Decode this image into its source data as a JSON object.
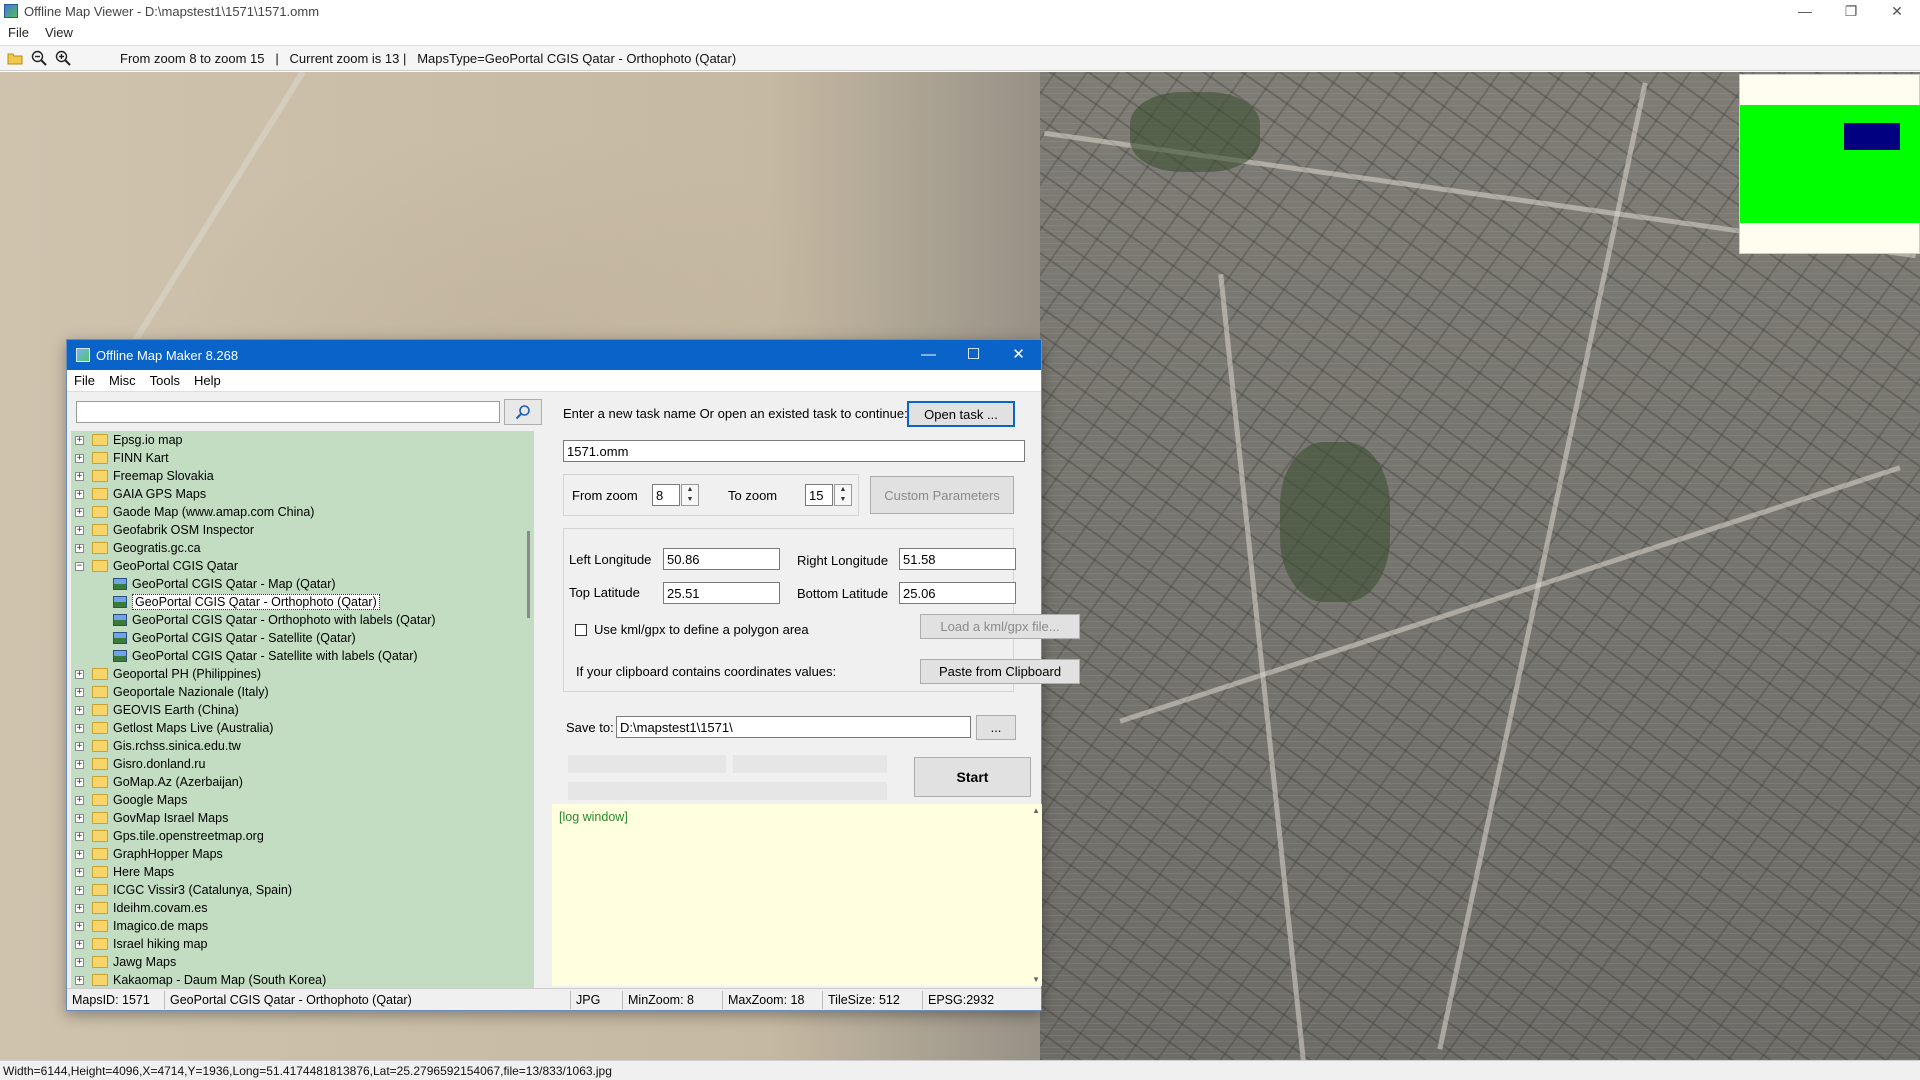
{
  "window": {
    "title": "Offline Map Viewer - D:\\mapstest1\\1571\\1571.omm",
    "minimize": "—",
    "maximize": "❐",
    "close": "✕"
  },
  "menu": [
    "File",
    "View"
  ],
  "toolbar": {
    "info": "From zoom 8 to zoom 15   |   Current zoom is 13 |   MapsType=GeoPortal CGIS Qatar - Orthophoto (Qatar)"
  },
  "statusbar": {
    "text": "Width=6144,Height=4096,X=4714,Y=1936,Long=51.4174481813876,Lat=25.2796592154067,file=13/833/1063.jpg"
  },
  "dialog": {
    "title": "Offline Map Maker 8.268",
    "minimize": "—",
    "maximize": "☐",
    "close": "✕",
    "menu": [
      "File",
      "Misc",
      "Tools",
      "Help"
    ],
    "search_placeholder": "",
    "tree": [
      {
        "label": "Epsg.io map",
        "type": "folder"
      },
      {
        "label": "FINN Kart",
        "type": "folder"
      },
      {
        "label": "Freemap Slovakia",
        "type": "folder"
      },
      {
        "label": "GAIA GPS Maps",
        "type": "folder"
      },
      {
        "label": "Gaode Map (www.amap.com China)",
        "type": "folder"
      },
      {
        "label": "Geofabrik OSM Inspector",
        "type": "folder"
      },
      {
        "label": "Geogratis.gc.ca",
        "type": "folder"
      },
      {
        "label": "GeoPortal CGIS Qatar",
        "type": "folder-open"
      },
      {
        "label": "GeoPortal CGIS Qatar - Map (Qatar)",
        "type": "child"
      },
      {
        "label": "GeoPortal CGIS Qatar - Orthophoto (Qatar)",
        "type": "child",
        "selected": true
      },
      {
        "label": "GeoPortal CGIS Qatar - Orthophoto with labels (Qatar)",
        "type": "child"
      },
      {
        "label": "GeoPortal CGIS Qatar - Satellite (Qatar)",
        "type": "child"
      },
      {
        "label": "GeoPortal CGIS Qatar - Satellite with labels (Qatar)",
        "type": "child"
      },
      {
        "label": "Geoportal PH (Philippines)",
        "type": "folder"
      },
      {
        "label": "Geoportale Nazionale (Italy)",
        "type": "folder"
      },
      {
        "label": "GEOVIS Earth (China)",
        "type": "folder"
      },
      {
        "label": "Getlost Maps Live (Australia)",
        "type": "folder"
      },
      {
        "label": "Gis.rchss.sinica.edu.tw",
        "type": "folder"
      },
      {
        "label": "Gisro.donland.ru",
        "type": "folder"
      },
      {
        "label": "GoMap.Az (Azerbaijan)",
        "type": "folder"
      },
      {
        "label": "Google Maps",
        "type": "folder"
      },
      {
        "label": "GovMap Israel Maps",
        "type": "folder"
      },
      {
        "label": "Gps.tile.openstreetmap.org",
        "type": "folder"
      },
      {
        "label": "GraphHopper Maps",
        "type": "folder"
      },
      {
        "label": "Here Maps",
        "type": "folder"
      },
      {
        "label": "ICGC Vissir3 (Catalunya, Spain)",
        "type": "folder"
      },
      {
        "label": "Ideihm.covam.es",
        "type": "folder"
      },
      {
        "label": "Imagico.de maps",
        "type": "folder"
      },
      {
        "label": "Israel hiking map",
        "type": "folder"
      },
      {
        "label": "Jawg Maps",
        "type": "folder"
      },
      {
        "label": "Kakaomap - Daum Map (South Korea)",
        "type": "folder"
      }
    ],
    "task_prompt": "Enter a new task name Or open an existed task to continue:",
    "open_task": "Open task ...",
    "task_name": "1571.omm",
    "from_zoom_label": "From zoom",
    "from_zoom": "8",
    "to_zoom_label": "To zoom",
    "to_zoom": "15",
    "custom_params": "Custom Parameters",
    "left_lon_label": "Left Longitude",
    "left_lon": "50.86",
    "right_lon_label": "Right Longitude",
    "right_lon": "51.58",
    "top_lat_label": "Top Latitude",
    "top_lat": "25.51",
    "bottom_lat_label": "Bottom Latitude",
    "bottom_lat": "25.06",
    "use_kml_label": "Use kml/gpx to define a polygon area",
    "load_kml": "Load a kml/gpx file...",
    "clipboard_label": "If your clipboard contains coordinates values:",
    "paste_clipboard": "Paste from Clipboard",
    "save_to_label": "Save to:",
    "save_to": "D:\\mapstest1\\1571\\",
    "browse": "...",
    "start": "Start",
    "log_label": "[log window]",
    "status": {
      "maps_id": "MapsID: 1571",
      "maps_name": "GeoPortal CGIS Qatar - Orthophoto (Qatar)",
      "format": "JPG",
      "min_zoom": "MinZoom: 8",
      "max_zoom": "MaxZoom: 18",
      "tile_size": "TileSize: 512",
      "epsg": "EPSG:2932"
    }
  }
}
